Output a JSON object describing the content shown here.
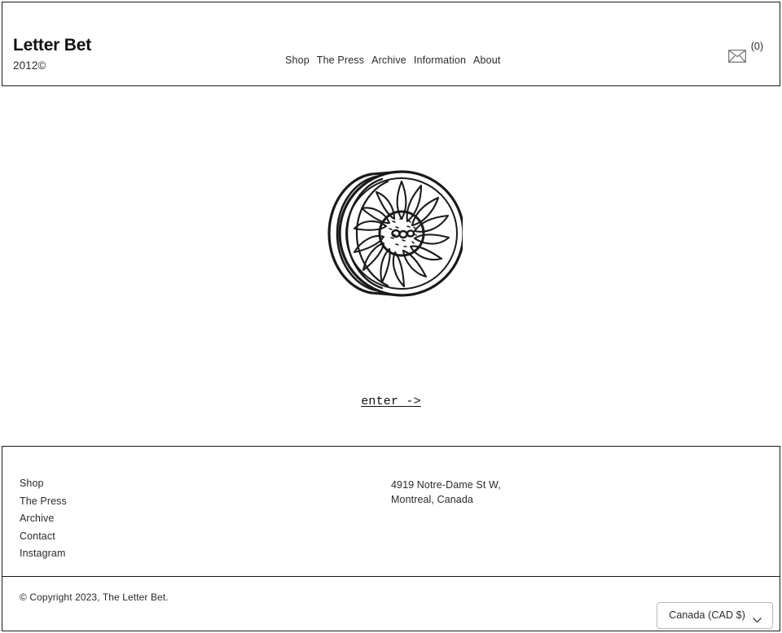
{
  "header": {
    "brand_title": "Letter Bet",
    "brand_subtitle": "2012©",
    "nav": [
      {
        "label": "Shop"
      },
      {
        "label": "The Press"
      },
      {
        "label": "Archive"
      },
      {
        "label": "Information"
      },
      {
        "label": "About"
      }
    ],
    "cart": {
      "icon": "envelope-icon",
      "count_label": "(0)"
    }
  },
  "main": {
    "artwork": {
      "icon": "wheel-flower-illustration",
      "description": "Hand-drawn tire wheel with sunflower-style spoke rim"
    },
    "enter_link": "enter ->"
  },
  "footer": {
    "links": [
      {
        "label": "Shop"
      },
      {
        "label": "The Press"
      },
      {
        "label": "Archive"
      },
      {
        "label": "Contact"
      },
      {
        "label": "Instagram"
      }
    ],
    "address": {
      "line1": "4919 Notre-Dame St W,",
      "line2": "Montreal, Canada"
    },
    "copyright": "© Copyright 2023, The Letter Bet.",
    "currency": {
      "selected": "Canada (CAD $)",
      "chevron": "chevron-down-icon"
    }
  },
  "colors": {
    "text": "#2a2a2a",
    "border": "#1a1a1a",
    "background": "#ffffff",
    "select_border": "#b8b8b8"
  }
}
